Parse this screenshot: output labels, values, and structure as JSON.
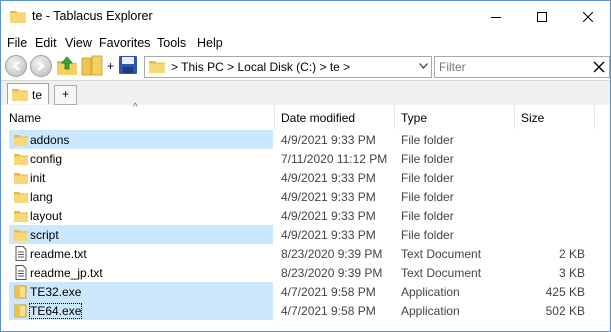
{
  "window": {
    "title": "te - Tablacus Explorer"
  },
  "menu": [
    "File",
    "Edit",
    "View",
    "Favorites",
    "Tools",
    "Help"
  ],
  "toolbar": {
    "plus_label": "+"
  },
  "address": {
    "text": "> This PC > Local Disk (C:) > te >"
  },
  "filter": {
    "placeholder": "Filter"
  },
  "tabs": [
    {
      "label": "te"
    }
  ],
  "tab_add_label": "+",
  "columns": {
    "name": "Name",
    "date": "Date modified",
    "type": "Type",
    "size": "Size"
  },
  "rows": [
    {
      "name": "addons",
      "date": "4/9/2021 9:33 PM",
      "type": "File folder",
      "size": "",
      "icon": "folder-icon",
      "selected": true
    },
    {
      "name": "config",
      "date": "7/11/2020 11:12 PM",
      "type": "File folder",
      "size": "",
      "icon": "folder-icon",
      "selected": false
    },
    {
      "name": "init",
      "date": "4/9/2021 9:33 PM",
      "type": "File folder",
      "size": "",
      "icon": "folder-icon",
      "selected": false
    },
    {
      "name": "lang",
      "date": "4/9/2021 9:33 PM",
      "type": "File folder",
      "size": "",
      "icon": "folder-icon",
      "selected": false
    },
    {
      "name": "layout",
      "date": "4/9/2021 9:33 PM",
      "type": "File folder",
      "size": "",
      "icon": "folder-icon",
      "selected": false
    },
    {
      "name": "script",
      "date": "4/9/2021 9:33 PM",
      "type": "File folder",
      "size": "",
      "icon": "folder-icon",
      "selected": true
    },
    {
      "name": "readme.txt",
      "date": "8/23/2020 9:39 PM",
      "type": "Text Document",
      "size": "2 KB",
      "icon": "text-file-icon",
      "selected": false
    },
    {
      "name": "readme_jp.txt",
      "date": "8/23/2020 9:39 PM",
      "type": "Text Document",
      "size": "3 KB",
      "icon": "text-file-icon",
      "selected": false
    },
    {
      "name": "TE32.exe",
      "date": "4/7/2021 9:58 PM",
      "type": "Application",
      "size": "425 KB",
      "icon": "exe-icon",
      "selected": true
    },
    {
      "name": "TE64.exe",
      "date": "4/7/2021 9:58 PM",
      "type": "Application",
      "size": "502 KB",
      "icon": "exe-icon",
      "selected": true,
      "focused": true
    }
  ]
}
